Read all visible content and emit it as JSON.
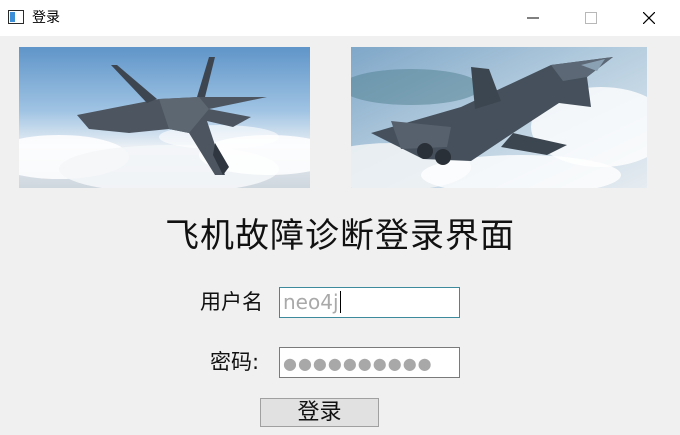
{
  "window": {
    "title": "登录",
    "icon": "app-window-icon",
    "controls": [
      "minimize-icon",
      "maximize-icon",
      "close-icon"
    ]
  },
  "images": [
    {
      "name": "fighter-jet-photo-left",
      "subject": "J-20 fighter jet above clouds"
    },
    {
      "name": "fighter-jet-photo-right",
      "subject": "J-20 fighter jet above clouds"
    }
  ],
  "form": {
    "heading": "飞机故障诊断登录界面",
    "username_label": "用户名",
    "username_value": "neo4j",
    "password_label": "密码:",
    "password_mask": "●●●●●●●●●●",
    "login_button": "登录"
  },
  "colors": {
    "background": "#f0f0f0",
    "titlebar": "#ffffff",
    "focused_border": "#3c8a9c"
  }
}
